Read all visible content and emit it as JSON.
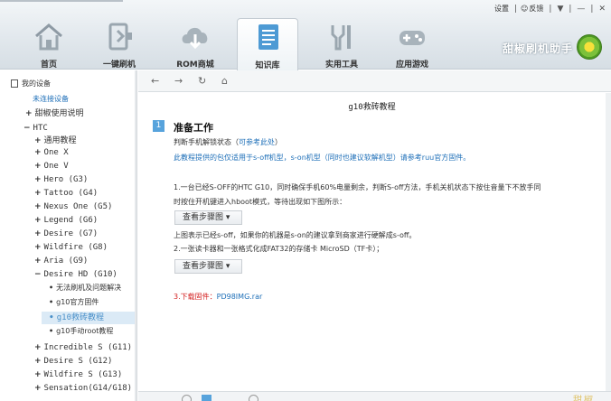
{
  "window": {
    "settings": "设置",
    "feedback": "反馈",
    "min": "▼",
    "minimize": "—",
    "close": "✕",
    "sep": "|"
  },
  "nav": [
    {
      "label": "首页",
      "icon": "home-icon"
    },
    {
      "label": "一键刷机",
      "icon": "flash-icon"
    },
    {
      "label": "ROM商城",
      "icon": "cloud-download-icon"
    },
    {
      "label": "知识库",
      "icon": "document-icon"
    },
    {
      "label": "实用工具",
      "icon": "tools-icon"
    },
    {
      "label": "应用游戏",
      "icon": "gamepad-icon"
    }
  ],
  "brand": "甜椒刷机助手",
  "sidebar": {
    "title": "我的设备",
    "subtitle": "未连接设备",
    "items": [
      {
        "pm": "+",
        "text": "甜椒使用说明"
      },
      {
        "pm": "−",
        "text": "HTC"
      },
      {
        "pm": "+",
        "text": "通用教程"
      },
      {
        "pm": "+",
        "text": "One X"
      },
      {
        "pm": "+",
        "text": "One V"
      },
      {
        "pm": "+",
        "text": "Hero (G3)"
      },
      {
        "pm": "+",
        "text": "Tattoo (G4)"
      },
      {
        "pm": "+",
        "text": "Nexus One (G5)"
      },
      {
        "pm": "+",
        "text": "Legend (G6)"
      },
      {
        "pm": "+",
        "text": "Desire (G7)"
      },
      {
        "pm": "+",
        "text": "Wildfire (G8)"
      },
      {
        "pm": "+",
        "text": "Aria (G9)"
      },
      {
        "pm": "−",
        "text": "Desire HD (G10)"
      },
      {
        "pm": "•",
        "text": "无法刷机及问题解决"
      },
      {
        "pm": "•",
        "text": "g10官方固件"
      },
      {
        "pm": "•",
        "text": "g10救砖教程"
      },
      {
        "pm": "•",
        "text": "g10手动root教程"
      },
      {
        "pm": "+",
        "text": "Incredible S (G11)"
      },
      {
        "pm": "+",
        "text": "Desire S (G12)"
      },
      {
        "pm": "+",
        "text": "Wildfire S (G13)"
      },
      {
        "pm": "+",
        "text": "Sensation(G14/G18)"
      }
    ]
  },
  "toolbar": {
    "back": "←",
    "forward": "→",
    "refresh": "↻",
    "home": "⌂"
  },
  "doc": {
    "title": "g10救砖教程",
    "step_num": "1",
    "step_title": "准备工作",
    "line1a": "判断手机解锁状态（",
    "line1b": "可参考此处",
    "line1c": "）",
    "line2": "此教程提供的包仅适用于s-off机型，s-on机型（同时也建议软解机型）请参考ruu官方固件。",
    "line3": "1.一台已经S-OFF的HTC G10，同时确保手机60%电量剩余，判断S-off方法，手机关机状态下按住音量下不放手同",
    "line4": "时按住开机键进入hboot模式，等待出现如下图所示：",
    "btn1": "查看步骤图 ▾",
    "line5": "上图表示已经s-off，如果你的机器是s-on的建议拿到商家进行硬解成s-off。",
    "line6": "2.一张读卡器和一张格式化成FAT32的存储卡 MicroSD（TF卡）；",
    "btn2": "查看步骤图 ▾",
    "line7a": "3.下载固件：",
    "line7b": "PD98IMG.rar"
  },
  "watermark": "甜椒",
  "colors": {
    "accent": "#57a3dc",
    "link": "#1e6fb8",
    "red": "#d42424"
  }
}
